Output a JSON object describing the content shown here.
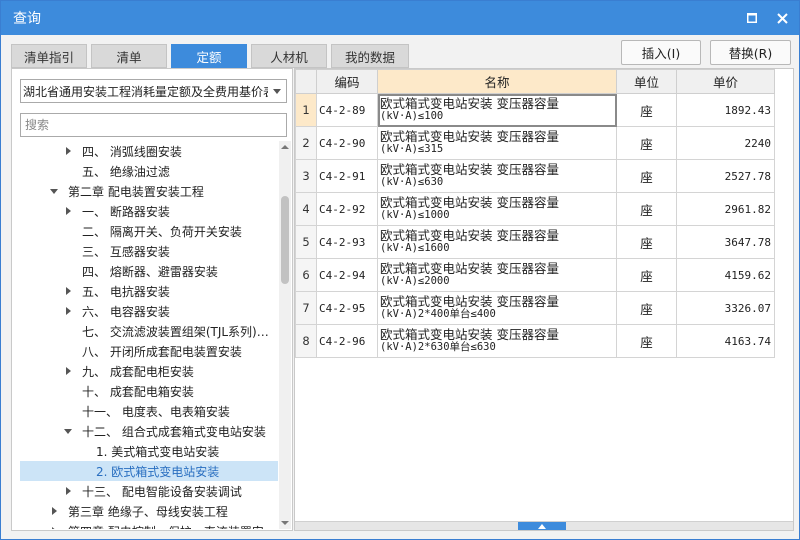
{
  "window": {
    "title": "查询"
  },
  "tabs": [
    {
      "label": "清单指引",
      "active": false
    },
    {
      "label": "清单",
      "active": false
    },
    {
      "label": "定额",
      "active": true
    },
    {
      "label": "人材机",
      "active": false
    },
    {
      "label": "我的数据",
      "active": false
    }
  ],
  "actions": {
    "insert": "插入(I)",
    "replace": "替换(R)"
  },
  "library": {
    "selected": "湖北省通用安装工程消耗量定额及全费用基价表"
  },
  "search": {
    "placeholder": "搜索",
    "value": ""
  },
  "tree": [
    {
      "label": "四、 消弧线圈安装",
      "indent": 3,
      "expander": "right"
    },
    {
      "label": "五、 绝缘油过滤",
      "indent": 3,
      "expander": "none"
    },
    {
      "label": "第二章 配电装置安装工程",
      "indent": 2,
      "expander": "down"
    },
    {
      "label": "一、 断路器安装",
      "indent": 3,
      "expander": "right"
    },
    {
      "label": "二、 隔离开关、负荷开关安装",
      "indent": 3,
      "expander": "none"
    },
    {
      "label": "三、 互感器安装",
      "indent": 3,
      "expander": "none"
    },
    {
      "label": "四、 熔断器、避雷器安装",
      "indent": 3,
      "expander": "none"
    },
    {
      "label": "五、 电抗器安装",
      "indent": 3,
      "expander": "right"
    },
    {
      "label": "六、 电容器安装",
      "indent": 3,
      "expander": "right"
    },
    {
      "label": "七、 交流滤波装置组架(TJL系列)…",
      "indent": 3,
      "expander": "none"
    },
    {
      "label": "八、 开闭所成套配电装置安装",
      "indent": 3,
      "expander": "none"
    },
    {
      "label": "九、 成套配电柜安装",
      "indent": 3,
      "expander": "right"
    },
    {
      "label": "十、 成套配电箱安装",
      "indent": 3,
      "expander": "none"
    },
    {
      "label": "十一、 电度表、电表箱安装",
      "indent": 3,
      "expander": "none"
    },
    {
      "label": "十二、 组合式成套箱式变电站安装",
      "indent": 3,
      "expander": "down"
    },
    {
      "label": "1. 美式箱式变电站安装",
      "indent": 4,
      "expander": "none"
    },
    {
      "label": "2. 欧式箱式变电站安装",
      "indent": 4,
      "expander": "none",
      "selected": true
    },
    {
      "label": "十三、 配电智能设备安装调试",
      "indent": 3,
      "expander": "right"
    },
    {
      "label": "第三章 绝缘子、母线安装工程",
      "indent": 2,
      "expander": "right"
    },
    {
      "label": "第四章 配电控制、保护、直流装置安…",
      "indent": 2,
      "expander": "right"
    }
  ],
  "grid": {
    "columns": [
      "编码",
      "名称",
      "单位",
      "单价"
    ],
    "rows": [
      {
        "no": "1",
        "code": "C4-2-89",
        "name1": "欧式箱式变电站安装 变压器容量",
        "name2": "(kV·A)≤100",
        "unit": "座",
        "price": "1892.43",
        "current": true
      },
      {
        "no": "2",
        "code": "C4-2-90",
        "name1": "欧式箱式变电站安装 变压器容量",
        "name2": "(kV·A)≤315",
        "unit": "座",
        "price": "2240"
      },
      {
        "no": "3",
        "code": "C4-2-91",
        "name1": "欧式箱式变电站安装 变压器容量",
        "name2": "(kV·A)≤630",
        "unit": "座",
        "price": "2527.78"
      },
      {
        "no": "4",
        "code": "C4-2-92",
        "name1": "欧式箱式变电站安装 变压器容量",
        "name2": "(kV·A)≤1000",
        "unit": "座",
        "price": "2961.82"
      },
      {
        "no": "5",
        "code": "C4-2-93",
        "name1": "欧式箱式变电站安装 变压器容量",
        "name2": "(kV·A)≤1600",
        "unit": "座",
        "price": "3647.78"
      },
      {
        "no": "6",
        "code": "C4-2-94",
        "name1": "欧式箱式变电站安装 变压器容量",
        "name2": "(kV·A)≤2000",
        "unit": "座",
        "price": "4159.62"
      },
      {
        "no": "7",
        "code": "C4-2-95",
        "name1": "欧式箱式变电站安装 变压器容量",
        "name2": "(kV·A)2*400单台≤400",
        "unit": "座",
        "price": "3326.07"
      },
      {
        "no": "8",
        "code": "C4-2-96",
        "name1": "欧式箱式变电站安装 变压器容量",
        "name2": "(kV·A)2*630单台≤630",
        "unit": "座",
        "price": "4163.74"
      }
    ]
  },
  "colors": {
    "accent": "#3d8bdc",
    "highlight": "#fde9c9",
    "selection": "#cce4f7"
  },
  "icons": {
    "maximize": "maximize-icon",
    "close": "close-icon",
    "dropdown": "chevron-down-icon"
  }
}
